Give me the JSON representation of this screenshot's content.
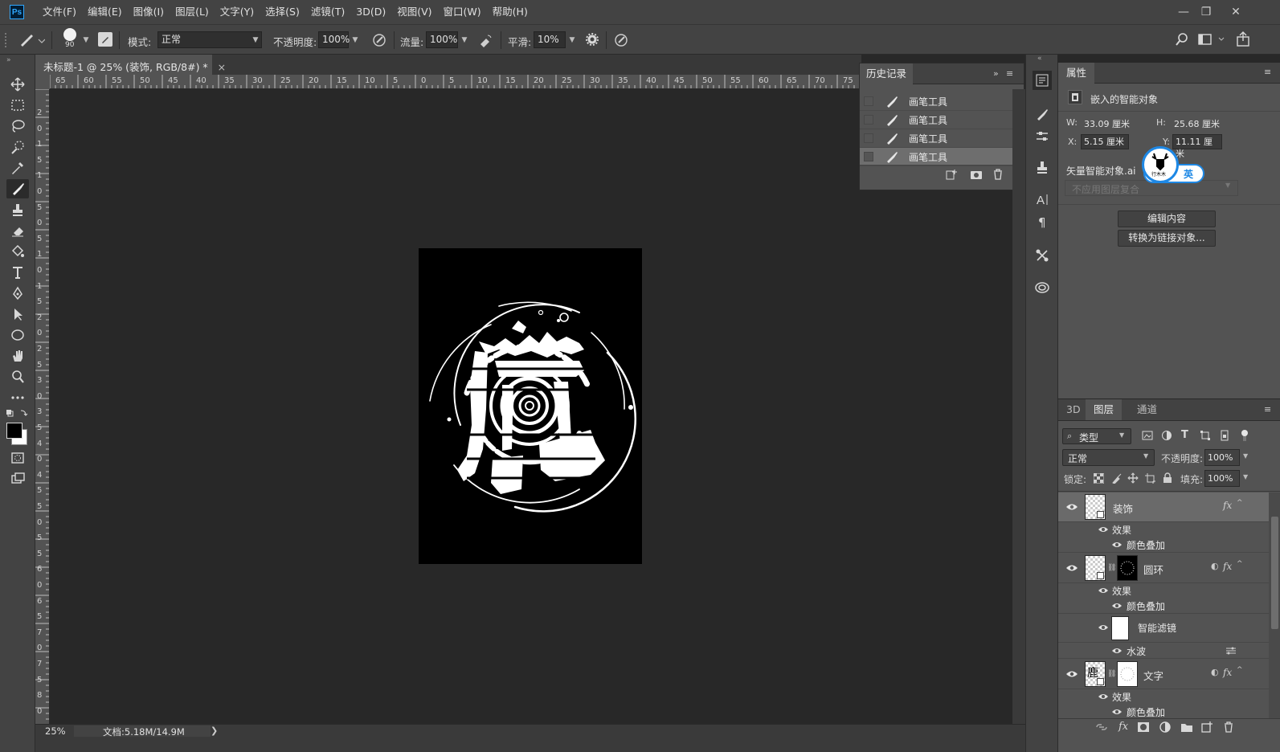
{
  "app": {
    "logo": "Ps"
  },
  "menu": [
    "文件(F)",
    "编辑(E)",
    "图像(I)",
    "图层(L)",
    "文字(Y)",
    "选择(S)",
    "滤镜(T)",
    "3D(D)",
    "视图(V)",
    "窗口(W)",
    "帮助(H)"
  ],
  "window_controls": {
    "minimize": "—",
    "restore": "❐",
    "close": "✕"
  },
  "options": {
    "brush_size": "90",
    "mode_label": "模式:",
    "mode_value": "正常",
    "opacity_label": "不透明度:",
    "opacity_value": "100%",
    "flow_label": "流量:",
    "flow_value": "100%",
    "smooth_label": "平滑:",
    "smooth_value": "10%"
  },
  "document": {
    "tab_title": "未标题-1 @ 25% (装饰, RGB/8#) *",
    "close": "×",
    "zoom": "25%",
    "doc_info": "文档:5.18M/14.9M",
    "hruler_labels": [
      "65",
      "60",
      "55",
      "50",
      "45",
      "40",
      "35",
      "30",
      "25",
      "20",
      "15",
      "10",
      "5",
      "0",
      "5",
      "10",
      "15",
      "20",
      "25",
      "30",
      "35",
      "40",
      "45",
      "50",
      "55",
      "60",
      "65",
      "70",
      "75"
    ],
    "vruler_labels": [
      "2",
      "0",
      "1",
      "5",
      "1",
      "0",
      "5",
      "0",
      "5",
      "1",
      "0",
      "1",
      "5",
      "2",
      "0",
      "2",
      "5",
      "3",
      "0",
      "3",
      "5",
      "4",
      "0",
      "4",
      "5",
      "5",
      "0",
      "5",
      "5",
      "6",
      "0",
      "6",
      "5",
      "7",
      "0",
      "7",
      "5",
      "8",
      "0"
    ]
  },
  "history": {
    "title": "历史记录",
    "items": [
      "画笔工具",
      "画笔工具",
      "画笔工具",
      "画笔工具"
    ],
    "selected_index": 3
  },
  "properties": {
    "title": "属性",
    "type": "嵌入的智能对象",
    "w_label": "W:",
    "w_value": "33.09 厘米",
    "h_label": "H:",
    "h_value": "25.68 厘米",
    "x_label": "X:",
    "x_value": "5.15 厘米",
    "y_label": "Y:",
    "y_value": "11.11 厘米",
    "file": "矢量智能对象.ai",
    "comp_placeholder": "不应用图层复合",
    "edit_button": "编辑内容",
    "convert_button": "转换为链接对象...",
    "ime_badge": "英",
    "ime_logo_text": "行木木"
  },
  "layers": {
    "tabs": [
      "3D",
      "图层",
      "通道"
    ],
    "active_tab": 1,
    "filter_label": "类型",
    "blend_mode": "正常",
    "opacity_label": "不透明度:",
    "opacity_value": "100%",
    "lock_label": "锁定:",
    "fill_label": "填充:",
    "fill_value": "100%",
    "effects_label": "效果",
    "color_overlay": "颜色叠加",
    "smart_filters": "智能滤镜",
    "ripple": "水波",
    "layer_names": [
      "装饰",
      "圆环",
      "文字"
    ]
  },
  "colors": {
    "accent": "#31a8ff",
    "panel": "#535353",
    "chrome": "#434343",
    "canvas_bg": "#282828"
  }
}
